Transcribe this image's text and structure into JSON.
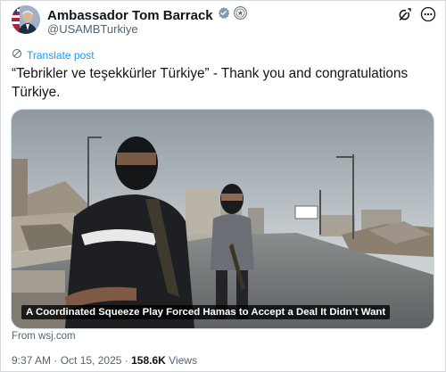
{
  "author": {
    "display_name": "Ambassador Tom Barrack",
    "handle": "@USAMBTurkiye",
    "verified_badge_icon": "gray-checkmark-badge-icon",
    "affiliate_badge_icon": "government-seal-icon"
  },
  "header_actions": {
    "grok_icon": "grok-icon",
    "more_icon": "more-options-icon"
  },
  "translate": {
    "label": "Translate post",
    "icon": "translate-globe-icon"
  },
  "post": {
    "text": "“Tebrikler ve teşekkürler Türkiye” - Thank you and congratulations Türkiye."
  },
  "link_card": {
    "headline": "A Coordinated Squeeze Play Forced Hamas to Accept a Deal It Didn’t Want",
    "source": "From wsj.com"
  },
  "meta": {
    "time": "9:37 AM",
    "date": "Oct 15, 2025",
    "separator": "·",
    "views_count": "158.6K",
    "views_label": "Views"
  },
  "colors": {
    "link_blue": "#1d9bf0",
    "text_primary": "#0f1419",
    "text_secondary": "#536471",
    "border": "#cfd9de"
  }
}
